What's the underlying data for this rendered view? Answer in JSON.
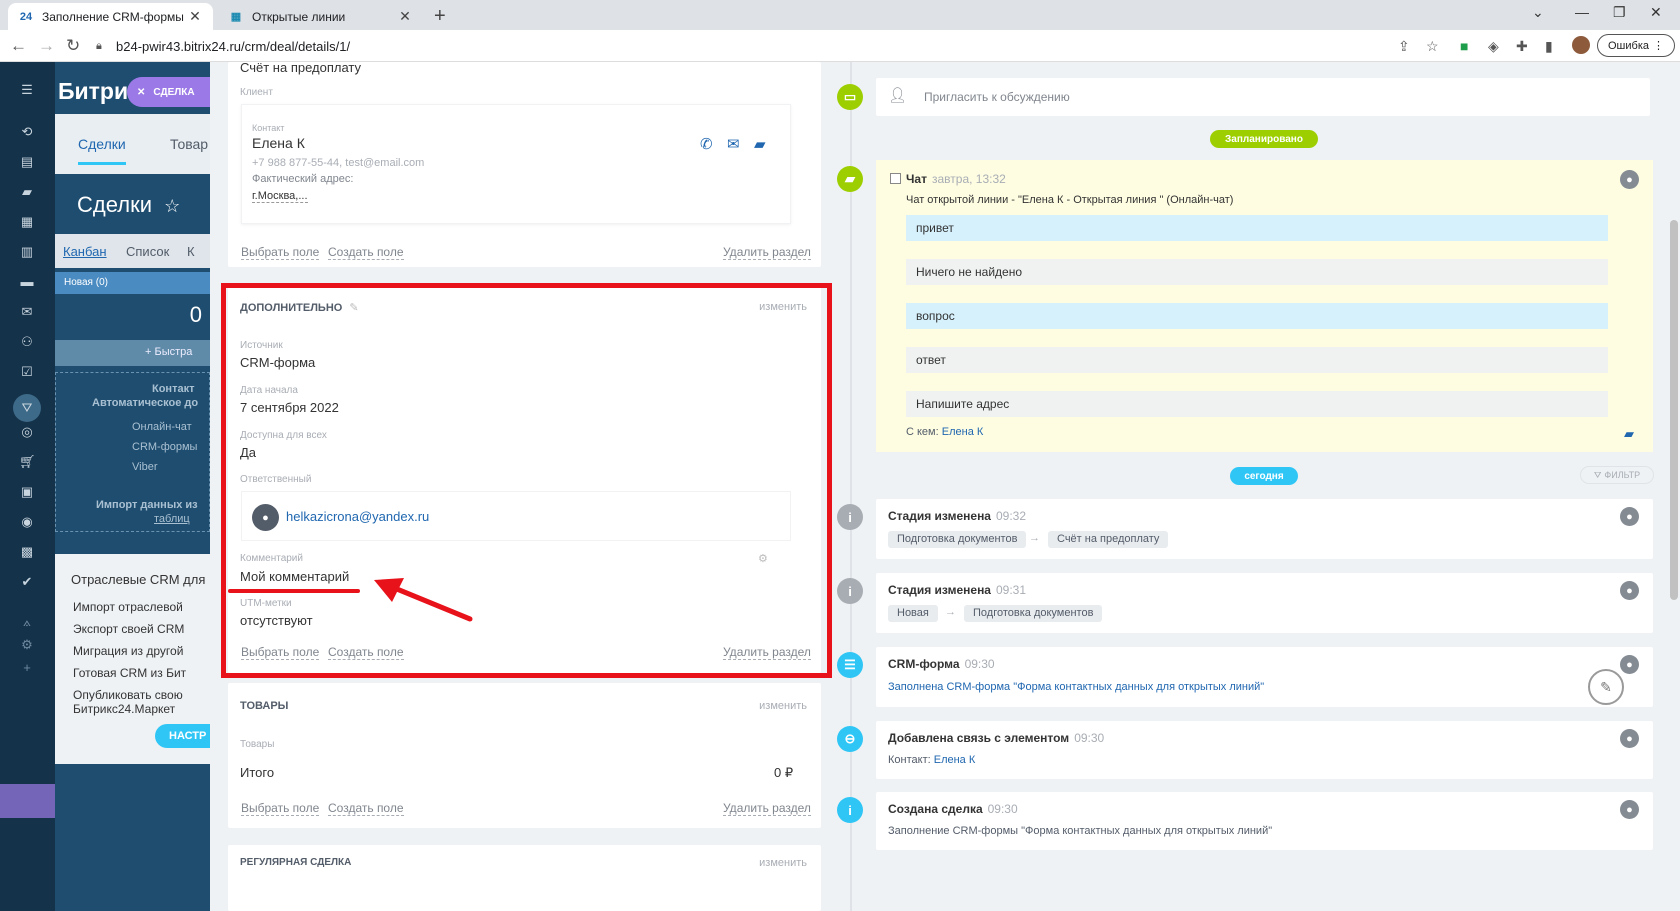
{
  "browser": {
    "tabs": [
      {
        "label": "Заполнение CRM-формы \"Фор",
        "favicon": "24"
      },
      {
        "label": "Открытые линии",
        "favicon": "▦"
      }
    ],
    "url": "b24-pwir43.bitrix24.ru/crm/deal/details/1/",
    "error_label": "Ошибка"
  },
  "bg_crm": {
    "logo": "Битрик",
    "deal_badge": "СДЕЛКА",
    "tabs": [
      "Сделки",
      "Товар"
    ],
    "page_title": "Сделки",
    "views": [
      "Канбан",
      "Список",
      "К"
    ],
    "column": "Новая (0)",
    "column_count": "0",
    "quick_add": "+ Быстра",
    "sources_title": "Контакт",
    "sources_sub": "Автоматическое до",
    "source_items": [
      "Онлайн-чат",
      "CRM-формы",
      "Viber"
    ],
    "import_text": "Импорт данных из",
    "import_link": "таблиц",
    "industry": {
      "title": "Отраслевые CRM для",
      "items": [
        "Импорт отраслевой",
        "Экспорт своей CRM",
        "Миграция из другой",
        "Готовая CRM из Бит",
        "Опубликовать свою",
        "Битрикс24.Маркет"
      ],
      "button": "НАСТР"
    }
  },
  "deal": {
    "top_value": "Счёт на предоплату",
    "client_label": "Клиент",
    "contact_label": "Контакт",
    "contact_name": "Елена К",
    "contact_info": "+7 988 877-55-44, test@email.com",
    "address_label": "Фактический адрес:",
    "address_value": "г.Москва,...",
    "actions": {
      "select": "Выбрать поле",
      "create": "Создать поле",
      "delete": "Удалить раздел"
    },
    "extra": {
      "title": "ДОПОЛНИТЕЛЬНО",
      "edit": "изменить",
      "source_label": "Источник",
      "source_value": "CRM-форма",
      "start_label": "Дата начала",
      "start_value": "7 сентября 2022",
      "public_label": "Доступна для всех",
      "public_value": "Да",
      "responsible_label": "Ответственный",
      "responsible_value": "helkazicrona@yandex.ru",
      "comment_label": "Комментарий",
      "comment_value": "Мой комментарий",
      "utm_label": "UTM-метки",
      "utm_value": "отсутствуют"
    },
    "products": {
      "title": "ТОВАРЫ",
      "edit": "изменить",
      "label": "Товары",
      "total_label": "Итого",
      "total_value": "0 ₽"
    },
    "recurring": {
      "title": "РЕГУЛЯРНАЯ СДЕЛКА",
      "edit": "изменить"
    }
  },
  "timeline": {
    "invite": "Пригласить к обсуждению",
    "planned_badge": "Запланировано",
    "today_badge": "сегодня",
    "filter": "ФИЛЬТР",
    "chat": {
      "title": "Чат",
      "time": "завтра, 13:32",
      "subtitle": "Чат открытой линии - \"Елена К - Открытая линия \" (Онлайн-чат)",
      "messages": [
        {
          "text": "привет",
          "dir": "in"
        },
        {
          "text": "Ничего не найдено",
          "dir": "out"
        },
        {
          "text": "вопрос",
          "dir": "in"
        },
        {
          "text": "ответ",
          "dir": "out"
        },
        {
          "text": "Напишите адрес",
          "dir": "out"
        }
      ],
      "with_label": "С кем:",
      "with_value": "Елена К"
    },
    "events": [
      {
        "title": "Стадия изменена",
        "time": "09:32",
        "from": "Подготовка документов",
        "to": "Счёт на предоплату"
      },
      {
        "title": "Стадия изменена",
        "time": "09:31",
        "from": "Новая",
        "to": "Подготовка документов"
      },
      {
        "title": "CRM-форма",
        "time": "09:30",
        "text": "Заполнена CRM-форма \"Форма контактных данных для открытых линий\""
      },
      {
        "title": "Добавлена связь с элементом",
        "time": "09:30",
        "text_label": "Контакт:",
        "text_value": "Елена К"
      },
      {
        "title": "Создана сделка",
        "time": "09:30",
        "text": "Заполнение CRM-формы \"Форма контактных данных для открытых линий\""
      }
    ]
  },
  "colors": {
    "accent": "#2fc6f6",
    "highlight": "#e8121a",
    "planned": "#9dcf00",
    "chat_bg": "#fefde2"
  }
}
